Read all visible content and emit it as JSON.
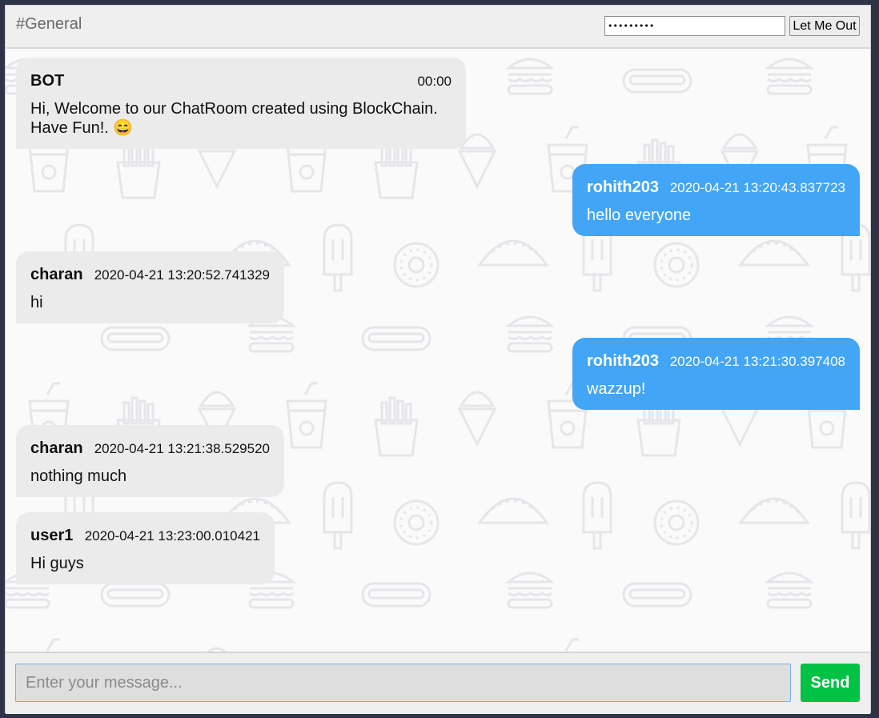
{
  "header": {
    "channel": "#General",
    "password_value": "•••••••••",
    "logout_label": "Let Me Out"
  },
  "messages": [
    {
      "user": "BOT",
      "time": "00:00",
      "text": "Hi, Welcome to our ChatRoom created using BlockChain. Have Fun!. 😄",
      "side": "in"
    },
    {
      "user": "rohith203",
      "time": "2020-04-21 13:20:43.837723",
      "text": "hello everyone",
      "side": "out"
    },
    {
      "user": "charan",
      "time": "2020-04-21 13:20:52.741329",
      "text": "hi",
      "side": "in"
    },
    {
      "user": "rohith203",
      "time": "2020-04-21 13:21:30.397408",
      "text": "wazzup!",
      "side": "out"
    },
    {
      "user": "charan",
      "time": "2020-04-21 13:21:38.529520",
      "text": "nothing much",
      "side": "in"
    },
    {
      "user": "user1",
      "time": "2020-04-21 13:23:00.010421",
      "text": "Hi guys",
      "side": "in"
    }
  ],
  "composer": {
    "placeholder": "Enter your message...",
    "send_label": "Send"
  },
  "colors": {
    "incoming_bubble": "#ebebeb",
    "outgoing_bubble": "#42a5f5",
    "send_button": "#00c244"
  },
  "background_icons": [
    "burger-icon",
    "hotdog-icon",
    "soda-cup-icon",
    "ice-cream-icon",
    "fries-icon",
    "popsicle-icon",
    "donut-icon",
    "taco-icon"
  ]
}
